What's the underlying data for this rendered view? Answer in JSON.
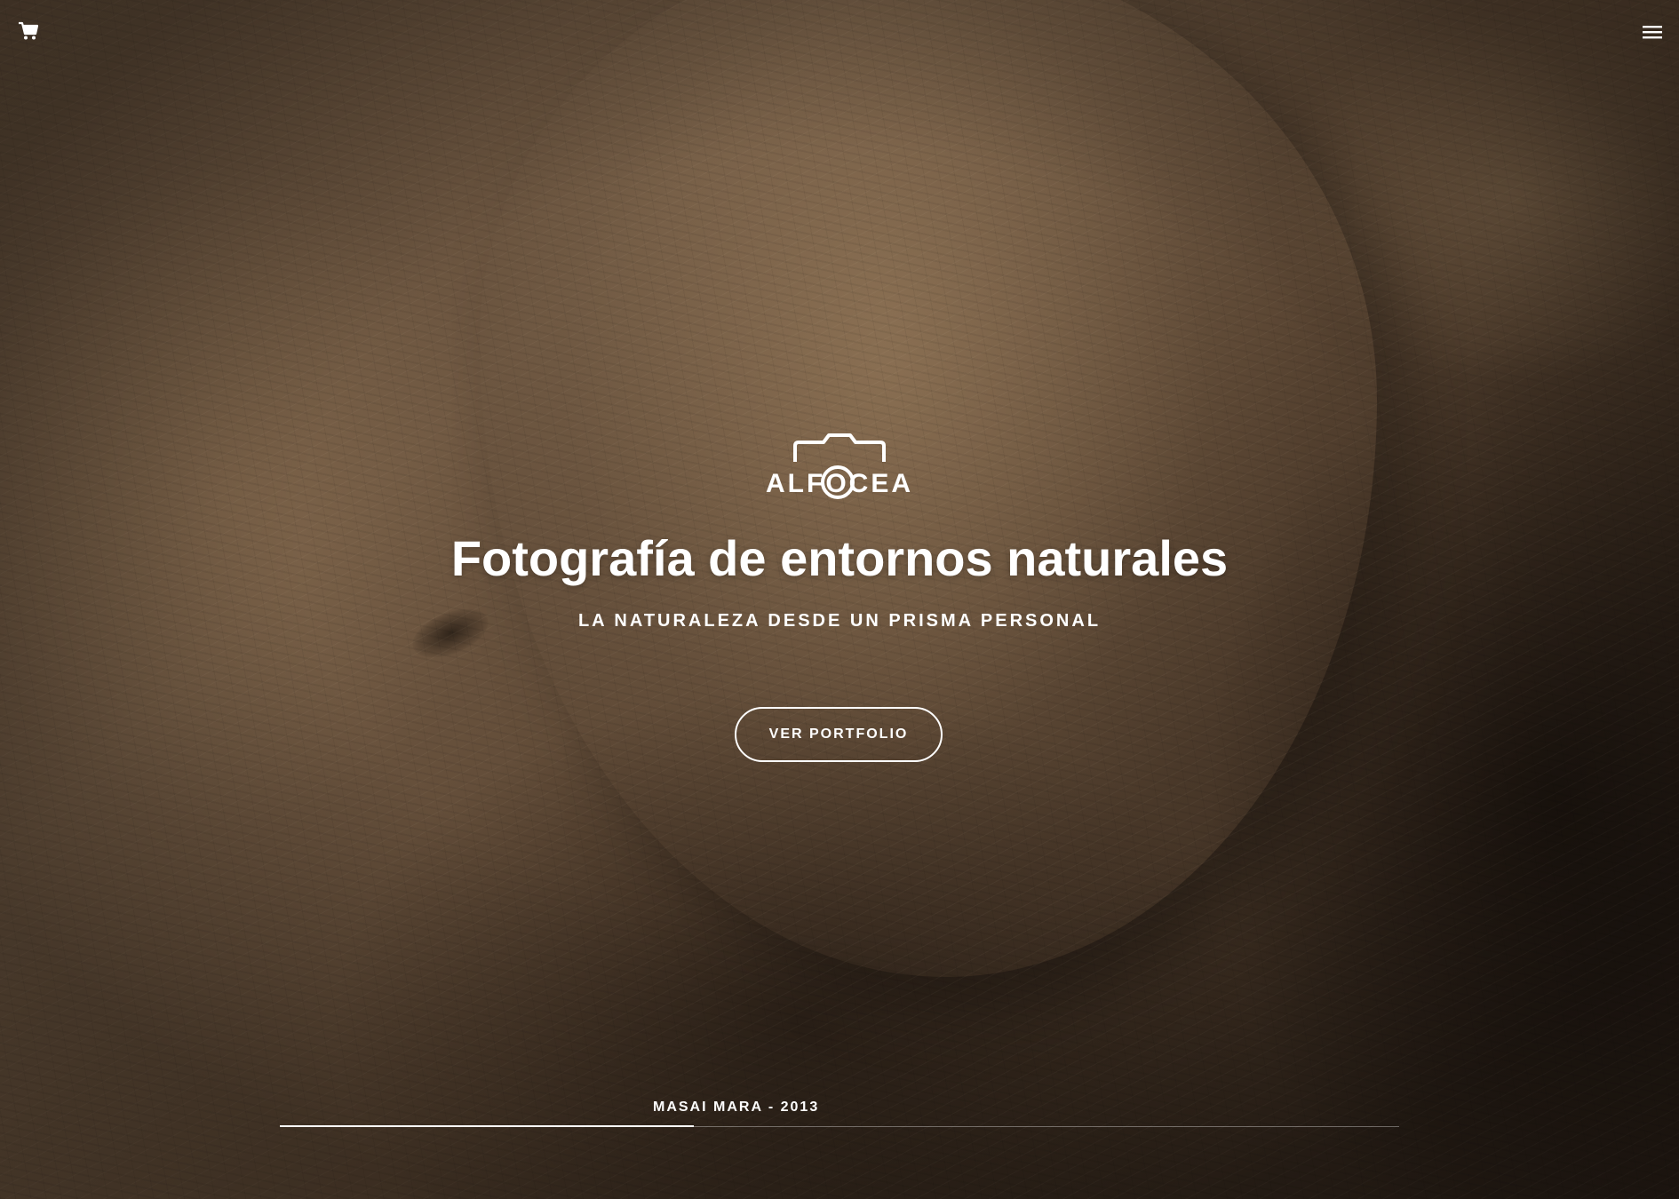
{
  "header": {
    "cart_icon": "cart-icon",
    "menu_icon": "menu-icon"
  },
  "brand": {
    "logo_text": "ALFOCEA",
    "logo_icon": "camera-icon"
  },
  "hero": {
    "title": "Fotografía de entornos naturales",
    "subtitle": "LA NATURALEZA DESDE UN PRISMA PERSONAL",
    "cta_label": "VER PORTFOLIO"
  },
  "slider": {
    "caption": "MASAI MARA - 2013",
    "progress": 0.37
  },
  "colors": {
    "text": "#ffffff",
    "background": "#5e4a37"
  }
}
